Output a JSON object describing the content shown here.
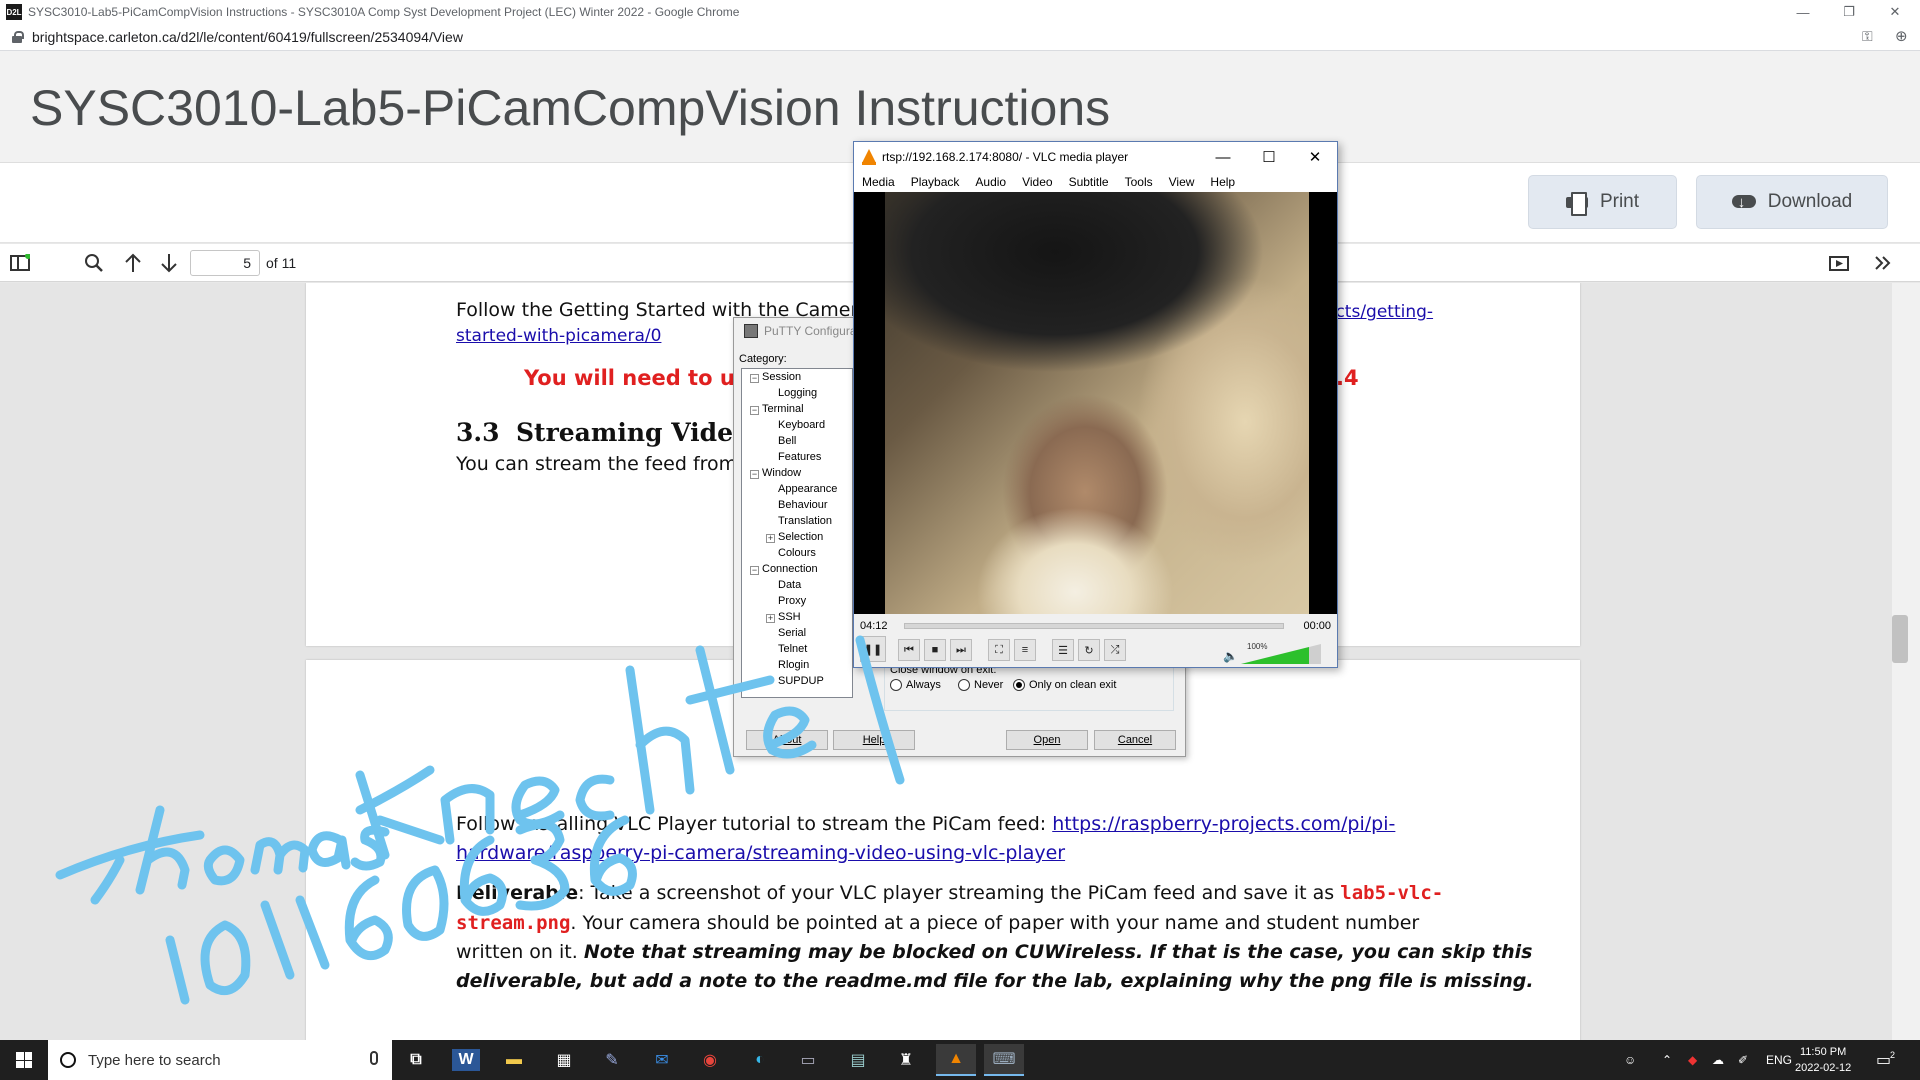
{
  "browser": {
    "window_title": "SYSC3010-Lab5-PiCamCompVision Instructions - SYSC3010A Comp Syst Development Project (LEC) Winter 2022 - Google Chrome",
    "favicon_text": "D2L",
    "url": "brightspace.carleton.ca/d2l/le/content/60419/fullscreen/2534094/View"
  },
  "page": {
    "title": "SYSC3010-Lab5-PiCamCompVision Instructions",
    "print_label": "Print",
    "download_label": "Download"
  },
  "pdf_toolbar": {
    "current_page": "5",
    "of_label": "of 11"
  },
  "document": {
    "line1": "Follow the Getting Started with the Camer",
    "line1_link_end": "ects/getting-",
    "line2_link": "started-with-picamera/0",
    "red_warning": "You will need to und",
    "red_warning_end": ".4",
    "section_number": "3.3",
    "section_title": "Streaming Video",
    "section_body": "You can stream the feed from",
    "follow_vlc": "Follow Installing VLC Player tutorial to stream the PiCam feed: ",
    "vlc_link_1": "https://raspberry-projects.com/pi/pi-",
    "vlc_link_2": "hardware/raspberry-pi-camera/streaming-video-using-vlc-player",
    "deliverable_label": "Deliverable",
    "deliverable_text": ": Take a screenshot of your VLC player streaming the PiCam feed and save it as ",
    "deliverable_file_1": "lab5-vlc-",
    "deliverable_file_2": "stream.png",
    "deliverable_rest": ". Your camera should be pointed at a piece of paper with your name and student number",
    "written_on": "written on it. ",
    "note_1": "Note that streaming may be blocked on CUWireless. If that is the case, you can skip this",
    "note_2": "deliverable, but add a note to the readme.md file for the lab, explaining why the png file is missing."
  },
  "putty": {
    "title": "PuTTY Configura",
    "category_label": "Category:",
    "tree": [
      "Session",
      "Logging",
      "Terminal",
      "Keyboard",
      "Bell",
      "Features",
      "Window",
      "Appearance",
      "Behaviour",
      "Translation",
      "Selection",
      "Colours",
      "Connection",
      "Data",
      "Proxy",
      "SSH",
      "Serial",
      "Telnet",
      "Rlogin",
      "SUPDUP"
    ],
    "close_window_label": "Close window on exit:",
    "radio_always": "Always",
    "radio_never": "Never",
    "radio_clean": "Only on clean exit",
    "about_label": "About",
    "help_label": "Help",
    "open_label": "Open",
    "cancel_label": "Cancel"
  },
  "vlc": {
    "title": "rtsp://192.168.2.174:8080/ - VLC media player",
    "menu": [
      "Media",
      "Playback",
      "Audio",
      "Video",
      "Subtitle",
      "Tools",
      "View",
      "Help"
    ],
    "elapsed": "04:12",
    "remaining": "00:00",
    "volume": "100%",
    "volume_level": 1.0
  },
  "annotation": {
    "name": "Thomas Knechtel",
    "student_number": "101160636"
  },
  "taskbar": {
    "search_placeholder": "Type here to search",
    "language": "ENG",
    "time": "11:50 PM",
    "date": "2022-02-12",
    "notification_count": "2"
  },
  "colors": {
    "annotation_ink": "#6ec3ee",
    "link": "#1a0dab",
    "warning_red": "#e02020"
  }
}
